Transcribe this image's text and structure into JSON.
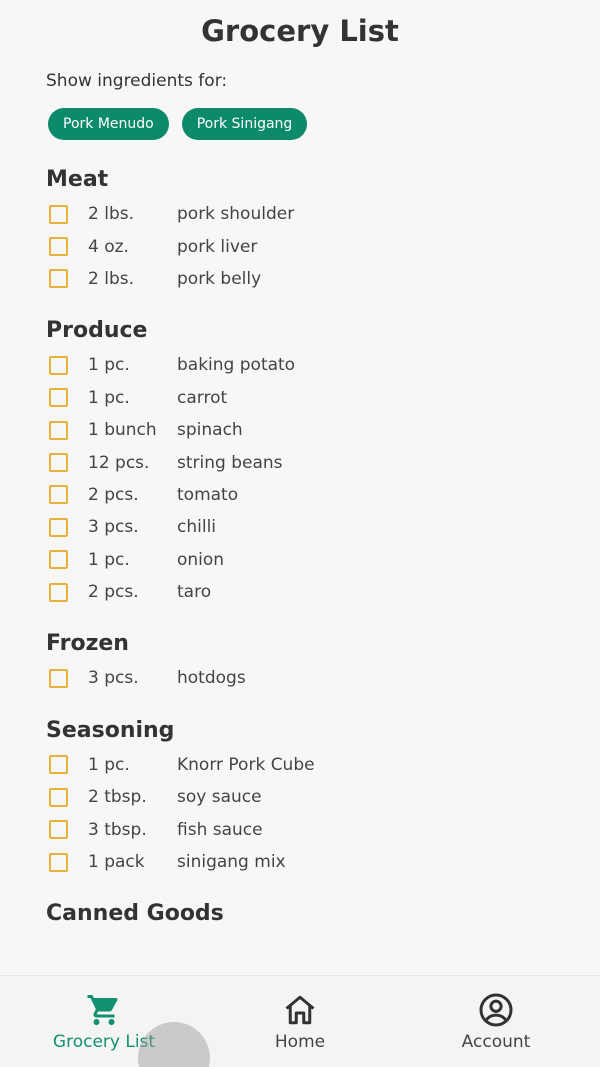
{
  "header": {
    "title": "Grocery List"
  },
  "filter": {
    "label": "Show ingredients for:",
    "chips": [
      "Pork Menudo",
      "Pork Sinigang"
    ]
  },
  "sections": [
    {
      "title": "Meat",
      "items": [
        {
          "qty": "2 lbs.",
          "name": "pork shoulder"
        },
        {
          "qty": "4 oz.",
          "name": "pork liver"
        },
        {
          "qty": "2 lbs.",
          "name": "pork belly"
        }
      ]
    },
    {
      "title": "Produce",
      "items": [
        {
          "qty": "1 pc.",
          "name": "baking potato"
        },
        {
          "qty": "1 pc.",
          "name": "carrot"
        },
        {
          "qty": "1 bunch",
          "name": "spinach"
        },
        {
          "qty": "12 pcs.",
          "name": "string beans"
        },
        {
          "qty": "2 pcs.",
          "name": "tomato"
        },
        {
          "qty": "3 pcs.",
          "name": "chilli"
        },
        {
          "qty": "1 pc.",
          "name": "onion"
        },
        {
          "qty": "2 pcs.",
          "name": "taro"
        }
      ]
    },
    {
      "title": "Frozen",
      "items": [
        {
          "qty": "3 pcs.",
          "name": "hotdogs"
        }
      ]
    },
    {
      "title": "Seasoning",
      "items": [
        {
          "qty": "1 pc.",
          "name": "Knorr Pork Cube"
        },
        {
          "qty": "2 tbsp.",
          "name": "soy sauce"
        },
        {
          "qty": "3 tbsp.",
          "name": "fish sauce"
        },
        {
          "qty": "1 pack",
          "name": "sinigang mix"
        }
      ]
    },
    {
      "title": "Canned Goods",
      "items": []
    }
  ],
  "nav": {
    "grocery_label": "Grocery List",
    "home_label": "Home",
    "account_label": "Account",
    "grocery_icon": "cart-icon",
    "home_icon": "home-icon",
    "account_icon": "account-icon"
  },
  "colors": {
    "accent": "#0d8a6a",
    "checkbox": "#e8b13a",
    "background": "#f7f7f8"
  }
}
